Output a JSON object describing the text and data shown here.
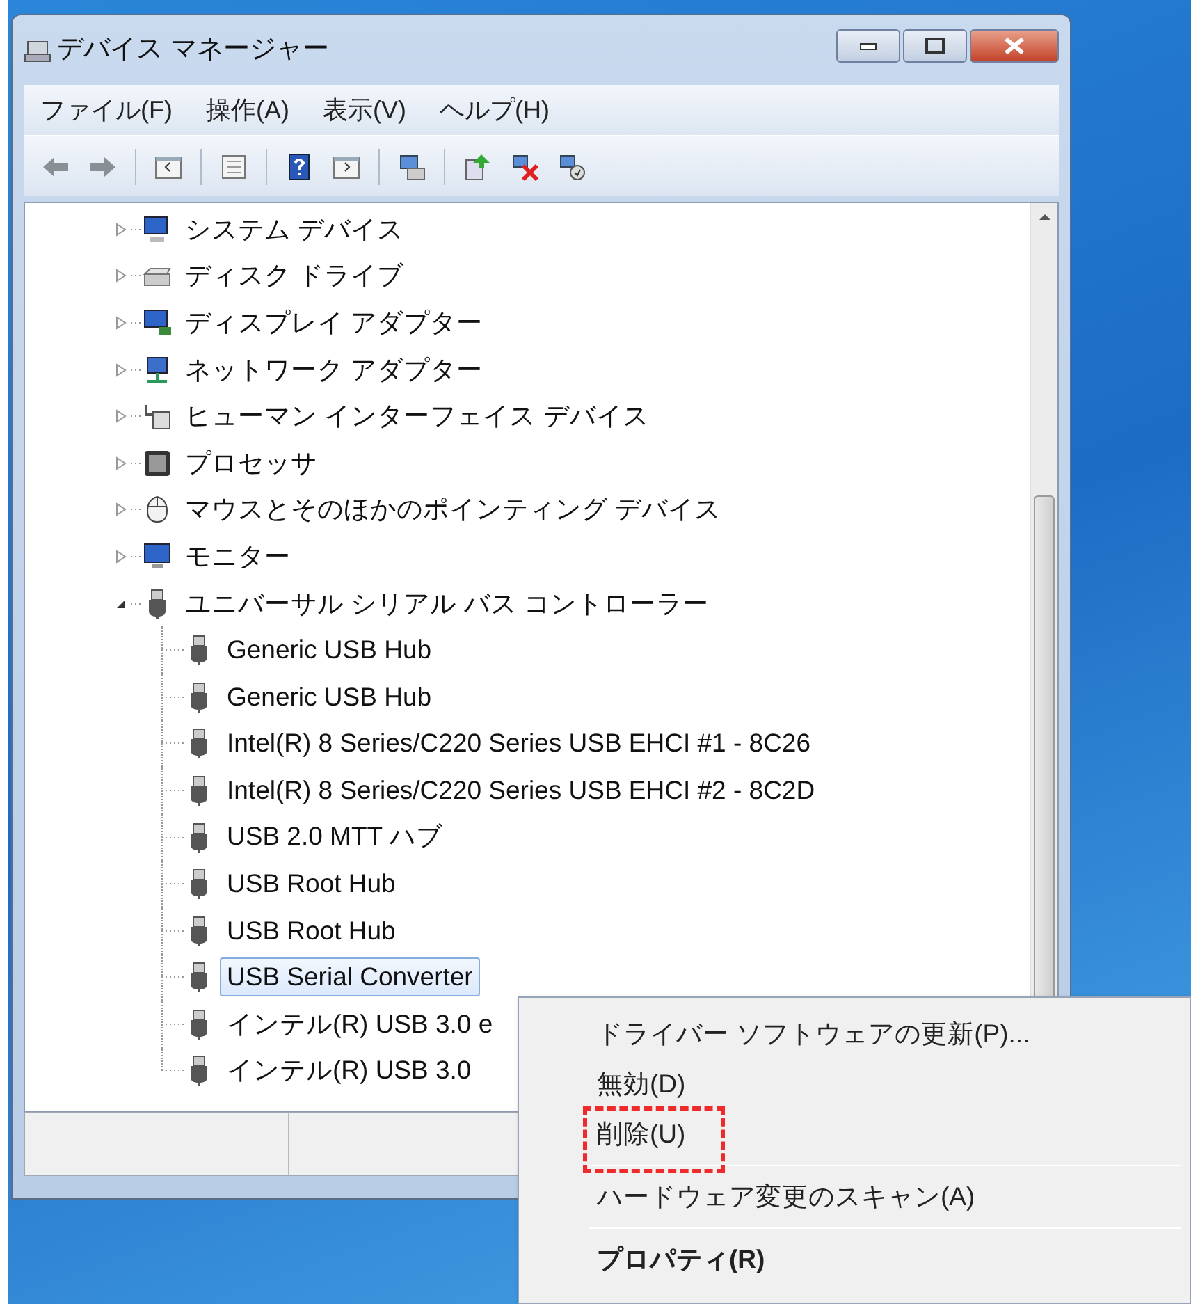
{
  "window": {
    "title": "デバイス マネージャー"
  },
  "menu_bar": [
    "ファイル(F)",
    "操作(A)",
    "表示(V)",
    "ヘルプ(H)"
  ],
  "toolbar": [
    {
      "kind": "back"
    },
    {
      "kind": "forward"
    },
    {
      "kind": "sep"
    },
    {
      "kind": "tree"
    },
    {
      "kind": "sep"
    },
    {
      "kind": "list"
    },
    {
      "kind": "sep"
    },
    {
      "kind": "help"
    },
    {
      "kind": "pane"
    },
    {
      "kind": "sep"
    },
    {
      "kind": "scan"
    },
    {
      "kind": "sep"
    },
    {
      "kind": "update"
    },
    {
      "kind": "remove"
    },
    {
      "kind": "disable"
    }
  ],
  "tree": {
    "items": [
      {
        "label": "システム デバイス",
        "kind": "system",
        "expanded": false,
        "selected": false
      },
      {
        "label": "ディスク ドライブ",
        "kind": "disk",
        "expanded": false,
        "selected": false
      },
      {
        "label": "ディスプレイ アダプター",
        "kind": "display",
        "expanded": false,
        "selected": false
      },
      {
        "label": "ネットワーク アダプター",
        "kind": "network",
        "expanded": false,
        "selected": false
      },
      {
        "label": "ヒューマン インターフェイス デバイス",
        "kind": "hid",
        "expanded": false,
        "selected": false
      },
      {
        "label": "プロセッサ",
        "kind": "cpu",
        "expanded": false,
        "selected": false
      },
      {
        "label": "マウスとそのほかのポインティング デバイス",
        "kind": "mouse",
        "expanded": false,
        "selected": false
      },
      {
        "label": "モニター",
        "kind": "monitor",
        "expanded": false,
        "selected": false
      },
      {
        "label": "ユニバーサル シリアル バス コントローラー",
        "kind": "usb",
        "expanded": true,
        "selected": false,
        "children": [
          {
            "label": "Generic USB Hub",
            "selected": false
          },
          {
            "label": "Generic USB Hub",
            "selected": false
          },
          {
            "label": "Intel(R) 8 Series/C220 Series USB EHCI #1 - 8C26",
            "selected": false
          },
          {
            "label": "Intel(R) 8 Series/C220 Series USB EHCI #2 - 8C2D",
            "selected": false
          },
          {
            "label": "USB 2.0 MTT ハブ",
            "selected": false
          },
          {
            "label": "USB Root Hub",
            "selected": false
          },
          {
            "label": "USB Root Hub",
            "selected": false
          },
          {
            "label": "USB Serial Converter",
            "selected": true
          },
          {
            "label": "インテル(R) USB 3.0 e",
            "selected": false
          },
          {
            "label": "インテル(R) USB 3.0",
            "selected": false
          }
        ]
      }
    ]
  },
  "context_menu": {
    "items": [
      {
        "label": "ドライバー ソフトウェアの更新(P)...",
        "bold": false,
        "highlighted": false,
        "separator_before": false
      },
      {
        "label": "無効(D)",
        "bold": false,
        "highlighted": false,
        "separator_before": false
      },
      {
        "label": "削除(U)",
        "bold": false,
        "highlighted": true,
        "separator_before": false
      },
      {
        "label": "ハードウェア変更のスキャン(A)",
        "bold": false,
        "highlighted": false,
        "separator_before": true
      },
      {
        "label": "プロパティ(R)",
        "bold": true,
        "highlighted": false,
        "separator_before": true
      }
    ]
  }
}
